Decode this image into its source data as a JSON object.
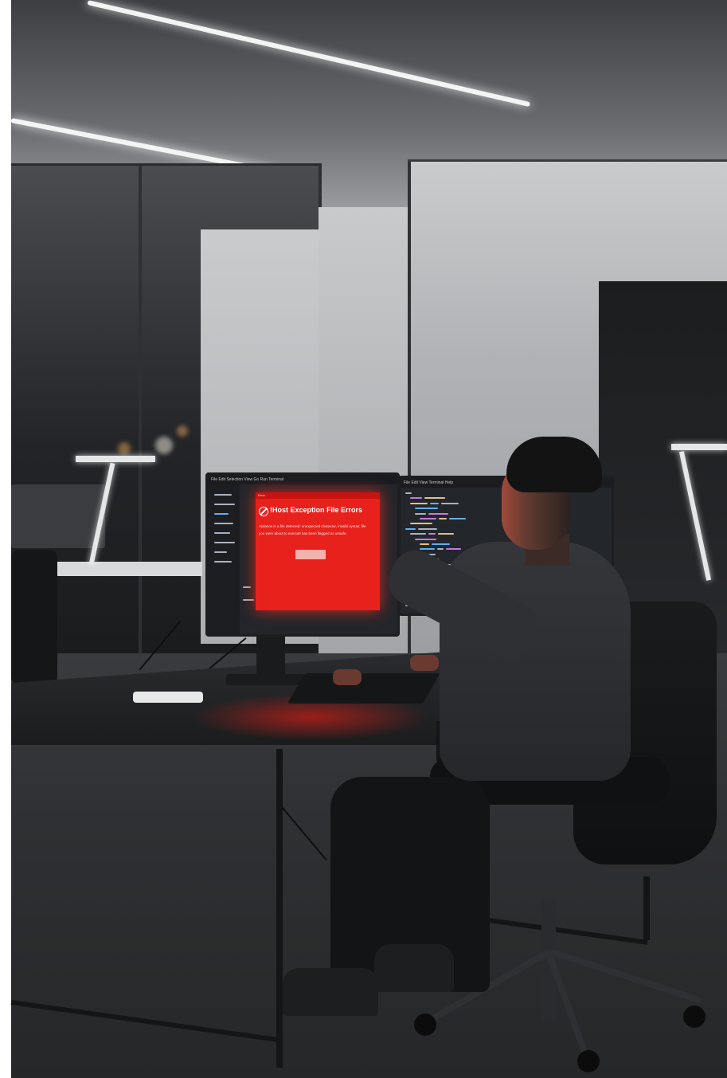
{
  "scene": {
    "description_ui": "office workstation photograph",
    "left_monitor": {
      "toolbar_text": "File  Edit  Selection  View  Go  Run  Terminal",
      "alert": {
        "titlebar": "Error",
        "title": "!Host Exception File Errors",
        "body_line_1": "Violation in a file detected: unexpected character, invalid syntax; file",
        "body_line_2": "you were about to execute has been flagged as unsafe."
      }
    },
    "right_monitor": {
      "toolbar_text": "File  Edit  View  Terminal  Help"
    }
  },
  "colors": {
    "alert_red": "#e8211d",
    "ide_background": "#23262b",
    "code_keyword": "#c678dd",
    "code_string": "#e5c07b",
    "code_plain": "#abb2bf",
    "code_function": "#61afef"
  }
}
